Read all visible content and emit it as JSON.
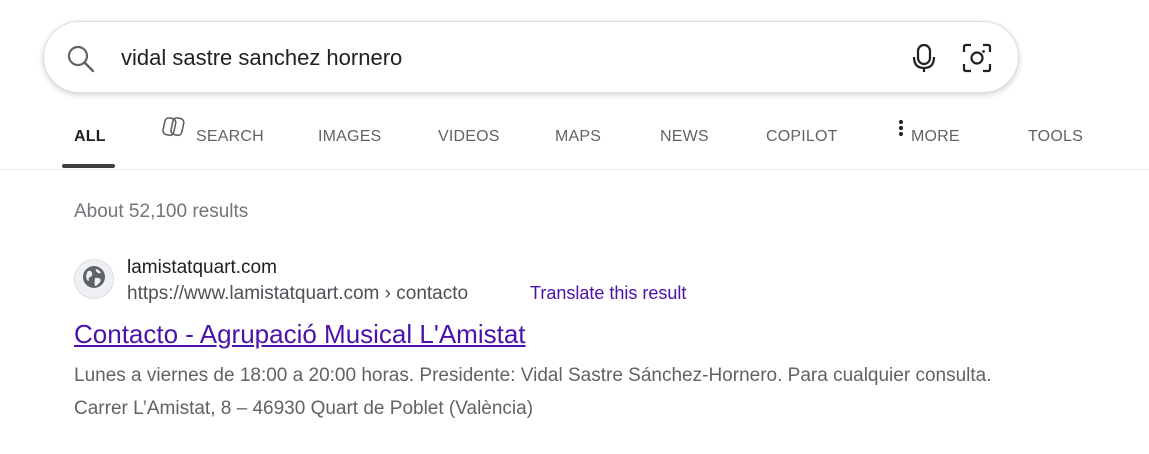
{
  "search": {
    "query": "vidal sastre sanchez hornero"
  },
  "tabs": [
    {
      "label": "ALL"
    },
    {
      "label": "SEARCH"
    },
    {
      "label": "IMAGES"
    },
    {
      "label": "VIDEOS"
    },
    {
      "label": "MAPS"
    },
    {
      "label": "NEWS"
    },
    {
      "label": "COPILOT"
    },
    {
      "label": "MORE"
    },
    {
      "label": "TOOLS"
    }
  ],
  "results_count": "About 52,100 results",
  "results": [
    {
      "site_name": "lamistatquart.com",
      "url": "https://www.lamistatquart.com › contacto",
      "translate_label": "Translate this result",
      "title": "Contacto - Agrupació Musical L'Amistat",
      "snippet": "Lunes a viernes de 18:00 a 20:00 horas. Presidente: Vidal Sastre Sánchez-Hornero. Para cualquier consulta. Carrer L’Amistat, 8 – 46930 Quart de Poblet (València)"
    }
  ],
  "colors": {
    "link": "#4b11a8",
    "tab_active": "#202124",
    "tab_inactive": "#5f6368",
    "muted": "#70757a"
  },
  "icons": {
    "search": "search-icon",
    "mic": "microphone-icon",
    "lens": "camera-lens-icon",
    "copilot_search": "copilot-search-icon",
    "more": "vertical-dots-icon",
    "favicon": "globe-icon"
  }
}
